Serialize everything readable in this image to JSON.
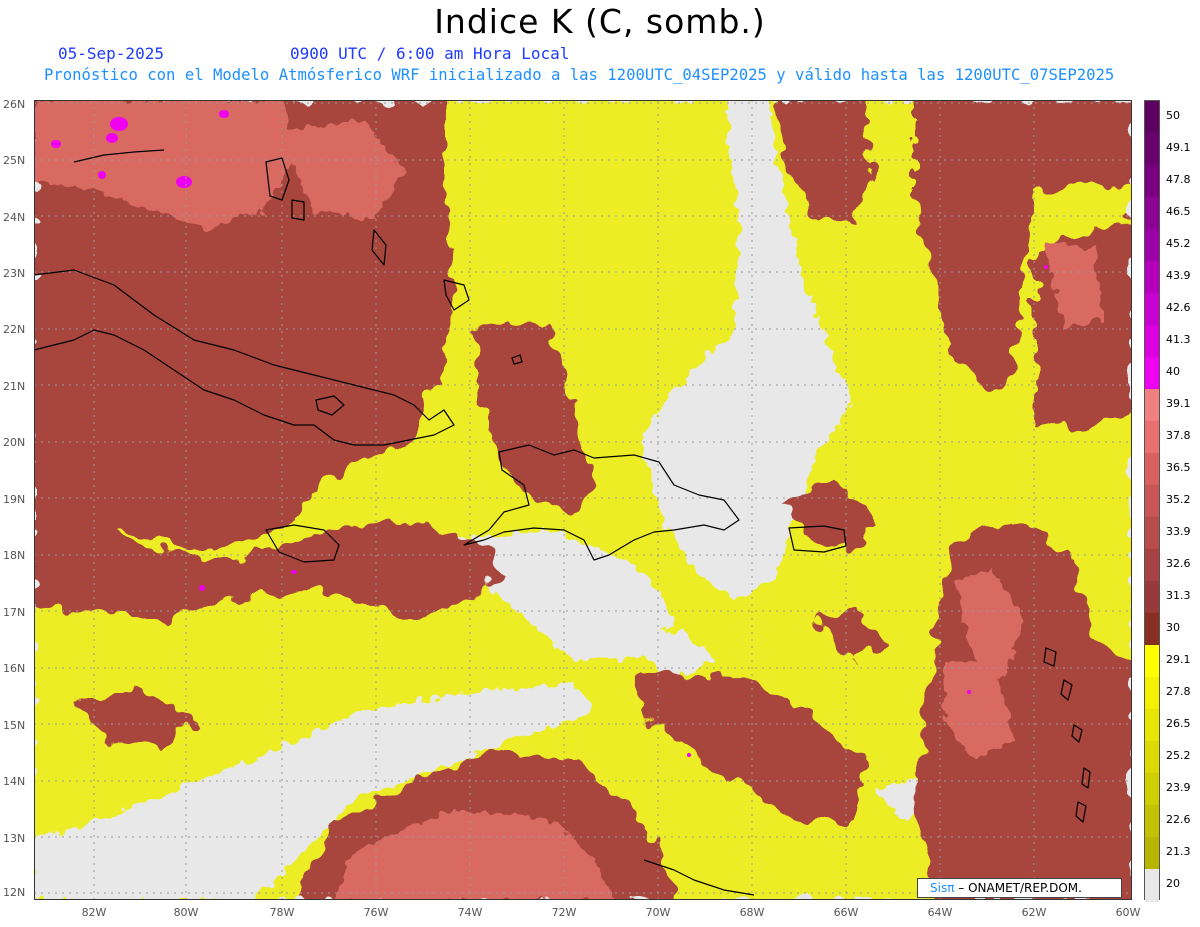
{
  "title": "Indice K (C, somb.)",
  "header": {
    "date": "05-Sep-2025",
    "time": "0900 UTC / 6:00 am Hora Local",
    "description": "Pronóstico con el Modelo Atmósferico WRF inicializado a las 1200UTC_04SEP2025 y válido hasta las  1200UTC_07SEP2025"
  },
  "axes": {
    "lat_labels": [
      "26N",
      "25N",
      "24N",
      "23N",
      "22N",
      "21N",
      "20N",
      "19N",
      "18N",
      "17N",
      "16N",
      "15N",
      "14N",
      "13N",
      "12N"
    ],
    "lon_labels": [
      "82W",
      "80W",
      "78W",
      "76W",
      "74W",
      "72W",
      "70W",
      "68W",
      "66W",
      "64W",
      "62W",
      "60W"
    ]
  },
  "colorbar": {
    "labels": [
      "50",
      "49.1",
      "47.8",
      "46.5",
      "45.2",
      "43.9",
      "42.6",
      "41.3",
      "40",
      "39.1",
      "37.8",
      "36.5",
      "35.2",
      "33.9",
      "32.6",
      "31.3",
      "30",
      "29.1",
      "27.8",
      "26.5",
      "25.2",
      "23.9",
      "22.6",
      "21.3",
      "20"
    ],
    "colors": [
      "#5e0060",
      "#6a006e",
      "#7a0080",
      "#8c0094",
      "#9e00a8",
      "#b400bc",
      "#c800d0",
      "#dc00e0",
      "#f000f0",
      "#f08080",
      "#e87070",
      "#d86060",
      "#c85656",
      "#b84c4c",
      "#a84242",
      "#983838",
      "#882e22",
      "#ffff00",
      "#f2f200",
      "#e6e600",
      "#dada00",
      "#cece00",
      "#c2c200",
      "#b6b600",
      "#e8e8e8"
    ]
  },
  "palette": {
    "gray": "#e8e8e8",
    "yellow": "#eded28",
    "brown": "#a8453e",
    "salmon": "#d96b62",
    "magenta": "#f000f0"
  },
  "credit": {
    "brand": "Sisπ",
    "org": "– ONAMET/REP.DOM."
  }
}
